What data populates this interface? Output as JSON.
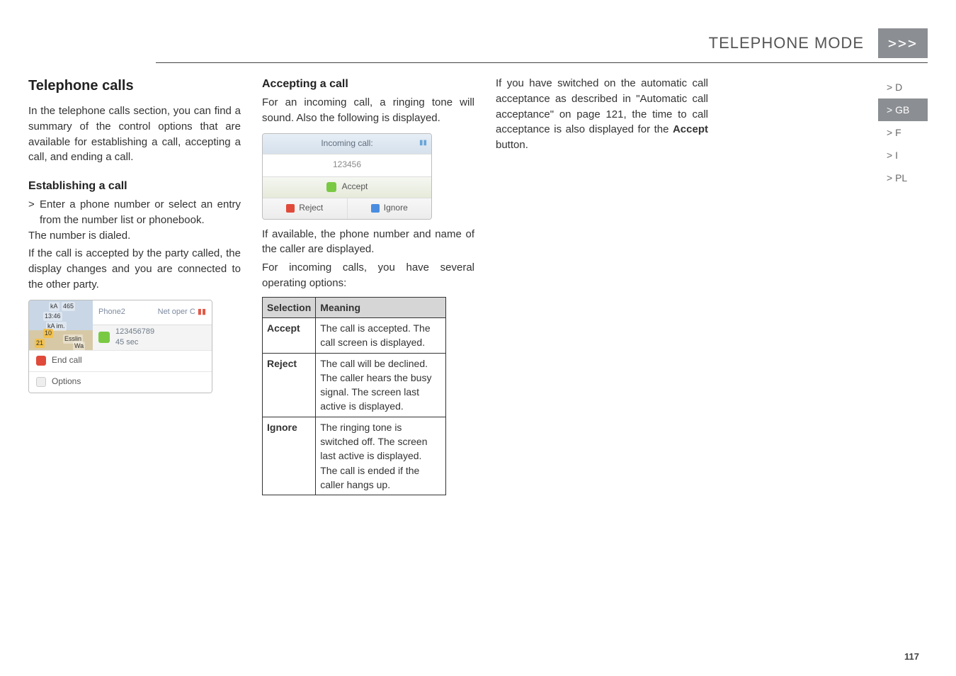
{
  "header": {
    "title": "TELEPHONE MODE",
    "chevrons": ">>>"
  },
  "sidebar": {
    "tabs": [
      {
        "label": "> D"
      },
      {
        "label": "> GB"
      },
      {
        "label": "> F"
      },
      {
        "label": "> I"
      },
      {
        "label": "> PL"
      }
    ],
    "active_index": 1
  },
  "col1": {
    "h2": "Telephone calls",
    "intro": "In the telephone calls section, you can find a summary of the control options that are available for establishing a call, accepting a call, and ending a call.",
    "h3": "Establishing a call",
    "bullet": "Enter a phone number or select an entry from the number list or phonebook.",
    "after_bullet_1": "The number is dialed.",
    "after_bullet_2": "If the call is accepted by the party called, the display changes and you are connected to the other party.",
    "shot": {
      "hud_ka": "kA",
      "hud_465": "465",
      "hud_time": "13:46",
      "hud_kaim": "kA im.",
      "hud_10": "10",
      "hud_esslin": "Esslin",
      "hud_21": "21",
      "hud_wa": "Wa",
      "phone_label": "Phone2",
      "net_label": "Net oper C",
      "number": "123456789",
      "duration": "45 sec",
      "btn_end": "End call",
      "btn_options": "Options"
    }
  },
  "col2": {
    "h3": "Accepting a call",
    "p1": "For an incoming call, a ringing tone will sound. Also the following is displayed.",
    "shot": {
      "incoming": "Incoming call:",
      "number": "123456",
      "accept": "Accept",
      "reject": "Reject",
      "ignore": "Ignore"
    },
    "p2": "If available, the phone number and name of the caller are displayed.",
    "p3": "For incoming calls, you have several operating options:",
    "table": {
      "head_sel": "Selection",
      "head_mean": "Meaning",
      "rows": [
        {
          "sel": "Accept",
          "mean": "The call is accepted. The call screen is displayed."
        },
        {
          "sel": "Reject",
          "mean": "The call will be declined. The caller hears the busy signal. The screen last active is displayed."
        },
        {
          "sel": "Ignore",
          "mean": "The ringing tone is switched off. The screen last active is displayed. The call is ended if the caller hangs up."
        }
      ]
    }
  },
  "col3": {
    "p_a": "If you have switched on the automatic call acceptance as described in \"Automatic call acceptance\" on page 121, the time to call acceptance is also displayed for the ",
    "p_bold": "Accept",
    "p_b": " button."
  },
  "footer": {
    "page": "117"
  }
}
